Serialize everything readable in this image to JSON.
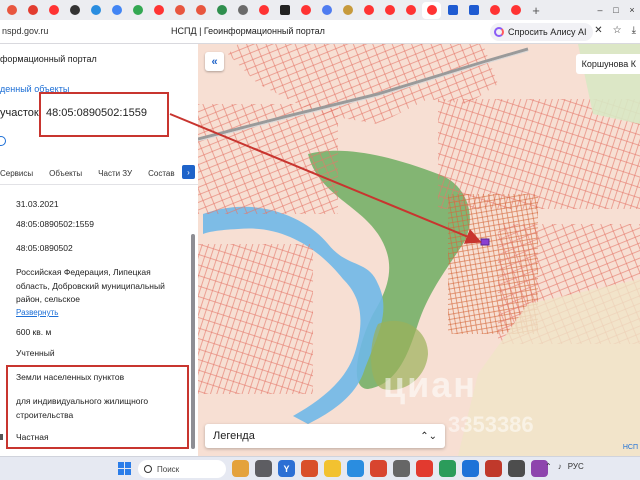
{
  "browser": {
    "tab_favicons": [
      {
        "icon": "generic-favicon-icon",
        "color": "#e8563f"
      },
      {
        "icon": "map-pin-favicon-icon",
        "color": "#e23c2f"
      },
      {
        "icon": "yandex-favicon-icon",
        "color": "#f33"
      },
      {
        "icon": "dark-circle-favicon-icon",
        "color": "#333333"
      },
      {
        "icon": "edge-favicon-icon",
        "color": "#2a8de0"
      },
      {
        "icon": "google-favicon-icon",
        "color": "#4285f4"
      },
      {
        "icon": "drive-favicon-icon",
        "color": "#34a853"
      },
      {
        "icon": "yandex-favicon-icon",
        "color": "#f33"
      },
      {
        "icon": "generic-favicon-icon",
        "color": "#e8563f"
      },
      {
        "icon": "generic-favicon-icon",
        "color": "#e8563f"
      },
      {
        "icon": "mail-favicon-icon",
        "color": "#2f8f4e"
      },
      {
        "icon": "camera-favicon-icon",
        "color": "#6b6b6b"
      },
      {
        "icon": "yandex-favicon-icon",
        "color": "#f33"
      },
      {
        "icon": "dark-square-favicon-icon",
        "color": "#222222"
      },
      {
        "icon": "yandex-favicon-icon",
        "color": "#f33"
      },
      {
        "icon": "diamond-favicon-icon",
        "color": "#4f7cf0"
      },
      {
        "icon": "sun-favicon-icon",
        "color": "#c79a3c"
      },
      {
        "icon": "yandex-favicon-icon",
        "color": "#f33"
      },
      {
        "icon": "yandex-favicon-icon",
        "color": "#f33"
      },
      {
        "icon": "yandex-favicon-icon",
        "color": "#f33"
      },
      {
        "icon": "yandex-favicon-icon",
        "color": "#f33"
      },
      {
        "icon": "flag-favicon-icon",
        "color": "#1f5bd1"
      },
      {
        "icon": "flag-favicon-icon",
        "color": "#1f5bd1"
      },
      {
        "icon": "yandex-favicon-icon",
        "color": "#f33"
      },
      {
        "icon": "yandex-favicon-icon",
        "color": "#f33"
      }
    ],
    "new_tab_label": "+",
    "url": "nspd.gov.ru",
    "page_title": "НСПД | Геоинформационный портал",
    "alice_label": "Спросить Алису AI",
    "window_controls": [
      "–",
      "□",
      "×"
    ]
  },
  "panel": {
    "portal_name": "формационный портал",
    "found_link": "денный объекты",
    "parcel_prefix": "участок",
    "parcel_number": "48:05:0890502:1559",
    "tabs": [
      "Сервисы",
      "Объекты",
      "Части ЗУ",
      "Состав"
    ],
    "tab_scroll_label": "›",
    "fields": {
      "date": "31.03.2021",
      "cadastral_number": "48:05:0890502:1559",
      "quarter": "48:05:0890502",
      "address": "Российская Федерация, Липецкая область, Добровский муниципальный район, сельское",
      "expand_link": "Развернуть",
      "area": "600 кв. м",
      "status": "Учтенный",
      "category": "Земли населенных пунктов",
      "permitted_use": "для индивидуального жилищного строительства",
      "ownership": "Частная"
    }
  },
  "map": {
    "collapse_label": "«",
    "place_label": "Коршунова К",
    "legend_label": "Легенда",
    "legend_toggle": "⌃⌄",
    "watermark": "циан",
    "watermark_id": "3353386",
    "corner_tag": "НСП"
  },
  "taskbar": {
    "search_placeholder": "Поиск",
    "tray_lang": "РУС"
  },
  "colors": {
    "annotation_red": "#c8352f",
    "link_blue": "#1d6fd6",
    "parcel_lines": "#e4776a",
    "forest_green": "#6fae62",
    "water_blue": "#6fb8e8",
    "land_pink": "#f7dfd3"
  }
}
